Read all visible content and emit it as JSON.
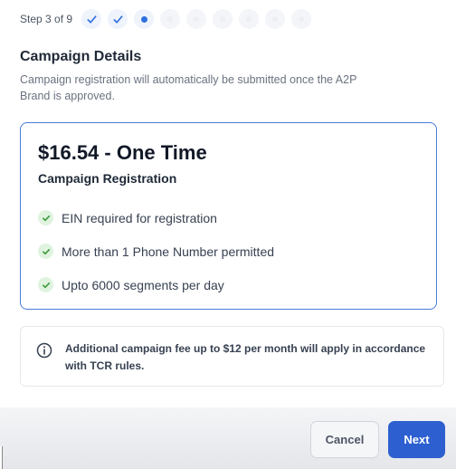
{
  "stepper": {
    "label": "Step 3 of 9",
    "current_step": 3,
    "total_steps": 9,
    "accent_color": "#2f6fe0"
  },
  "campaign": {
    "title": "Campaign Details",
    "description": "Campaign registration will automatically be submitted once the A2P Brand is approved."
  },
  "plan_card": {
    "price": "$16.54 - One Time",
    "subtitle": "Campaign Registration",
    "features": [
      "EIN required for registration",
      "More than 1 Phone Number permitted",
      "Upto 6000 segments per day"
    ]
  },
  "notice": {
    "icon": "info-icon",
    "text": "Additional campaign fee up to $12 per month will apply in accordance with TCR rules."
  },
  "footer": {
    "cancel_label": "Cancel",
    "next_label": "Next"
  }
}
